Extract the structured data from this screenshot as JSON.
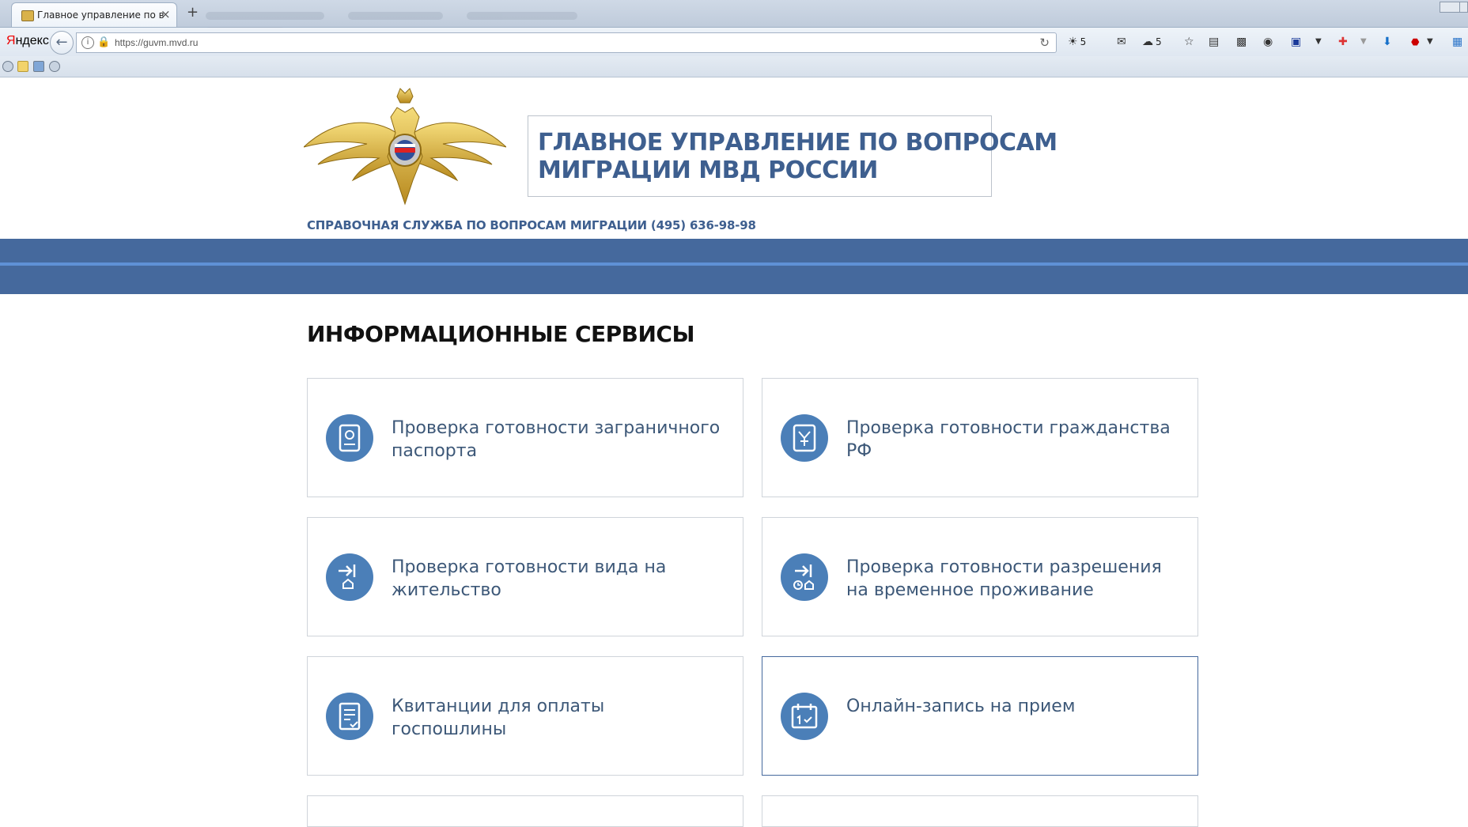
{
  "browser": {
    "tab_title": "Главное управление по в...",
    "tab_close": "×",
    "new_tab": "+",
    "yandex_logo_first": "Я",
    "yandex_logo_rest": "ндекс",
    "url": "https://guvm.mvd.ru",
    "toolbar": {
      "weather_count": "5",
      "cloud_count": "5"
    }
  },
  "header": {
    "title_line1": "ГЛАВНОЕ УПРАВЛЕНИЕ ПО ВОПРОСАМ",
    "title_line2": "МИГРАЦИИ МВД РОССИИ",
    "hotline": "СПРАВОЧНАЯ СЛУЖБА ПО ВОПРОСАМ МИГРАЦИИ (495) 636-98-98"
  },
  "services": {
    "section_title": "ИНФОРМАЦИОННЫЕ СЕРВИСЫ",
    "cards": [
      {
        "label": "Проверка готовности заграничного паспорта",
        "icon": "passport-icon"
      },
      {
        "label": "Проверка готовности гражданства РФ",
        "icon": "citizenship-icon"
      },
      {
        "label": "Проверка готовности вида на жительство",
        "icon": "residence-permit-icon"
      },
      {
        "label": "Проверка готовности разрешения на временное проживание",
        "icon": "temporary-residence-icon"
      },
      {
        "label": "Квитанции для оплаты госпошлины",
        "icon": "receipt-icon"
      },
      {
        "label": "Онлайн-запись на прием",
        "icon": "calendar-icon"
      }
    ]
  },
  "colors": {
    "brand_blue": "#45699d",
    "title_blue": "#3e5f8f",
    "icon_blue": "#4b7fb8"
  }
}
